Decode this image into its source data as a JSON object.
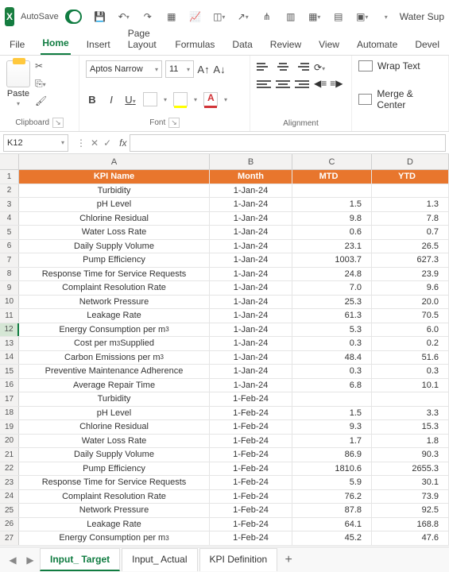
{
  "titleBar": {
    "autosave": "AutoSave",
    "autosaveOn": "On",
    "docTitle": "Water Sup"
  },
  "ribbonTabs": [
    "File",
    "Home",
    "Insert",
    "Page Layout",
    "Formulas",
    "Data",
    "Review",
    "View",
    "Automate",
    "Devel"
  ],
  "activeTab": "Home",
  "clipboard": {
    "paste": "Paste",
    "label": "Clipboard"
  },
  "font": {
    "name": "Aptos Narrow",
    "size": "11",
    "label": "Font"
  },
  "alignment": {
    "label": "Alignment",
    "wrap": "Wrap Text",
    "merge": "Merge & Center"
  },
  "nameBox": "K12",
  "formula": "",
  "columns": [
    "A",
    "B",
    "C",
    "D"
  ],
  "headerRow": {
    "a": "KPI Name",
    "b": "Month",
    "c": "MTD",
    "d": "YTD"
  },
  "rows": [
    {
      "n": 2,
      "a": "Turbidity",
      "b": "1-Jan-24",
      "c": "",
      "d": ""
    },
    {
      "n": 3,
      "a": "pH Level",
      "b": "1-Jan-24",
      "c": "1.5",
      "d": "1.3"
    },
    {
      "n": 4,
      "a": "Chlorine Residual",
      "b": "1-Jan-24",
      "c": "9.8",
      "d": "7.8"
    },
    {
      "n": 5,
      "a": "Water Loss Rate",
      "b": "1-Jan-24",
      "c": "0.6",
      "d": "0.7"
    },
    {
      "n": 6,
      "a": "Daily Supply Volume",
      "b": "1-Jan-24",
      "c": "23.1",
      "d": "26.5"
    },
    {
      "n": 7,
      "a": "Pump Efficiency",
      "b": "1-Jan-24",
      "c": "1003.7",
      "d": "627.3"
    },
    {
      "n": 8,
      "a": "Response Time for Service Requests",
      "b": "1-Jan-24",
      "c": "24.8",
      "d": "23.9"
    },
    {
      "n": 9,
      "a": "Complaint Resolution Rate",
      "b": "1-Jan-24",
      "c": "7.0",
      "d": "9.6"
    },
    {
      "n": 10,
      "a": "Network Pressure",
      "b": "1-Jan-24",
      "c": "25.3",
      "d": "20.0"
    },
    {
      "n": 11,
      "a": "Leakage Rate",
      "b": "1-Jan-24",
      "c": "61.3",
      "d": "70.5"
    },
    {
      "n": 12,
      "a": "Energy Consumption per m³",
      "b": "1-Jan-24",
      "c": "5.3",
      "d": "6.0",
      "sel": true
    },
    {
      "n": 13,
      "a": "Cost per m³ Supplied",
      "b": "1-Jan-24",
      "c": "0.3",
      "d": "0.2"
    },
    {
      "n": 14,
      "a": "Carbon Emissions per m³",
      "b": "1-Jan-24",
      "c": "48.4",
      "d": "51.6"
    },
    {
      "n": 15,
      "a": "Preventive Maintenance Adherence",
      "b": "1-Jan-24",
      "c": "0.3",
      "d": "0.3"
    },
    {
      "n": 16,
      "a": "Average Repair Time",
      "b": "1-Jan-24",
      "c": "6.8",
      "d": "10.1"
    },
    {
      "n": 17,
      "a": "Turbidity",
      "b": "1-Feb-24",
      "c": "",
      "d": ""
    },
    {
      "n": 18,
      "a": "pH Level",
      "b": "1-Feb-24",
      "c": "1.5",
      "d": "3.3"
    },
    {
      "n": 19,
      "a": "Chlorine Residual",
      "b": "1-Feb-24",
      "c": "9.3",
      "d": "15.3"
    },
    {
      "n": 20,
      "a": "Water Loss Rate",
      "b": "1-Feb-24",
      "c": "1.7",
      "d": "1.8"
    },
    {
      "n": 21,
      "a": "Daily Supply Volume",
      "b": "1-Feb-24",
      "c": "86.9",
      "d": "90.3"
    },
    {
      "n": 22,
      "a": "Pump Efficiency",
      "b": "1-Feb-24",
      "c": "1810.6",
      "d": "2655.3"
    },
    {
      "n": 23,
      "a": "Response Time for Service Requests",
      "b": "1-Feb-24",
      "c": "5.9",
      "d": "30.1"
    },
    {
      "n": 24,
      "a": "Complaint Resolution Rate",
      "b": "1-Feb-24",
      "c": "76.2",
      "d": "73.9"
    },
    {
      "n": 25,
      "a": "Network Pressure",
      "b": "1-Feb-24",
      "c": "87.8",
      "d": "92.5"
    },
    {
      "n": 26,
      "a": "Leakage Rate",
      "b": "1-Feb-24",
      "c": "64.1",
      "d": "168.8"
    },
    {
      "n": 27,
      "a": "Energy Consumption per m³",
      "b": "1-Feb-24",
      "c": "45.2",
      "d": "47.6"
    }
  ],
  "sheetTabs": [
    "Input_ Target",
    "Input_ Actual",
    "KPI Definition"
  ],
  "activeSheet": "Input_ Target"
}
